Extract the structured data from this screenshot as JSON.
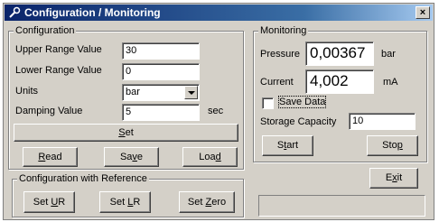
{
  "window": {
    "title": "Configuration / Monitoring",
    "close_label": "×"
  },
  "configuration": {
    "legend": "Configuration",
    "upper_range_label": "Upper Range Value",
    "upper_range_value": "30",
    "lower_range_label": "Lower Range Value",
    "lower_range_value": "0",
    "units_label": "Units",
    "units_value": "bar",
    "damping_label": "Damping Value",
    "damping_value": "5",
    "damping_unit": "sec",
    "set_prefix": "",
    "set_mnemonic": "S",
    "set_suffix": "et",
    "read_prefix": "",
    "read_mnemonic": "R",
    "read_suffix": "ead",
    "save_prefix": "Sa",
    "save_mnemonic": "v",
    "save_suffix": "e",
    "load_prefix": "Loa",
    "load_mnemonic": "d",
    "load_suffix": ""
  },
  "reference": {
    "legend": "Configuration with Reference",
    "set_ur_prefix": "Set ",
    "set_ur_mnemonic": "U",
    "set_ur_suffix": "R",
    "set_lr_prefix": "Set ",
    "set_lr_mnemonic": "L",
    "set_lr_suffix": "R",
    "set_zero_prefix": "Set ",
    "set_zero_mnemonic": "Z",
    "set_zero_suffix": "ero"
  },
  "monitoring": {
    "legend": "Monitoring",
    "pressure_label": "Pressure",
    "pressure_value": "0,00367",
    "pressure_unit": "bar",
    "current_label": "Current",
    "current_value": "4,002",
    "current_unit": "mA",
    "save_data_label": "Save Data",
    "storage_label": "Storage Capacity",
    "storage_value": "10",
    "start_prefix": "S",
    "start_mnemonic": "t",
    "start_suffix": "art",
    "stop_prefix": "Sto",
    "stop_mnemonic": "p",
    "stop_suffix": ""
  },
  "footer": {
    "exit_prefix": "E",
    "exit_mnemonic": "x",
    "exit_suffix": "it",
    "status_text": ""
  }
}
